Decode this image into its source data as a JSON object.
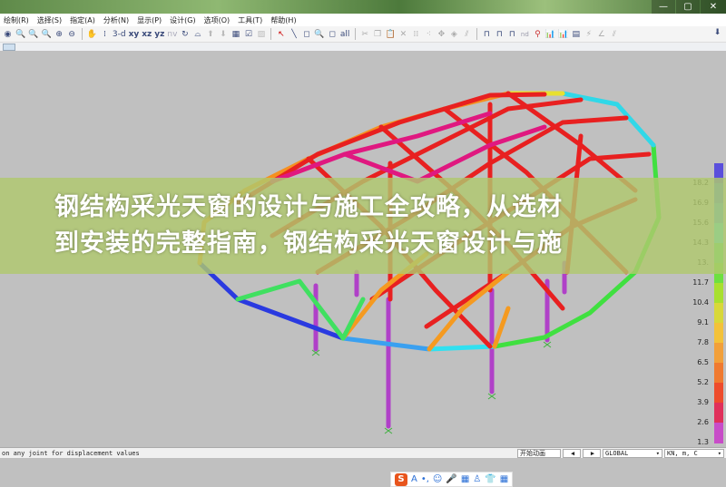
{
  "window": {
    "minimize": "—",
    "maximize": "▢",
    "close": "✕"
  },
  "menu": [
    "绘制(R)",
    "选择(S)",
    "指定(A)",
    "分析(N)",
    "显示(P)",
    "设计(G)",
    "选项(O)",
    "工具(T)",
    "帮助(H)"
  ],
  "toolbar": {
    "view_3d": "3-d",
    "view_xy": "xy",
    "view_xz": "xz",
    "view_yz": "yz",
    "view_nv": "nv",
    "nd": "nd",
    "all": "all"
  },
  "legend": {
    "labels": [
      "18.2",
      "16.9",
      "15.6",
      "14.3",
      "13.",
      "11.7",
      "10.4",
      "9.1",
      "7.8",
      "6.5",
      "5.2",
      "3.9",
      "2.6",
      "1.3"
    ],
    "colors": [
      "#5a4fdc",
      "#4b7fe0",
      "#4aa8e6",
      "#3fe0e8",
      "#55e070",
      "#6ee040",
      "#a8e030",
      "#d8d83a",
      "#f3c23a",
      "#f2a03a",
      "#f07a30",
      "#ee4c2c",
      "#e0305a",
      "#c84cc8"
    ]
  },
  "overlay": {
    "line1": "钢结构采光天窗的设计与施工全攻略，从选材",
    "line2": "到安装的完整指南，钢结构采光天窗设计与施"
  },
  "ime": {
    "logo": "S",
    "items": [
      "A",
      "•,",
      "☺",
      "🎤",
      "▦",
      "♙",
      "👕",
      "▦"
    ]
  },
  "status": {
    "message": "on any joint for displacement values",
    "animate": "开始动画",
    "prev": "◀",
    "next": "▶",
    "coord": "GLOBAL",
    "units": "KN, m, C"
  }
}
